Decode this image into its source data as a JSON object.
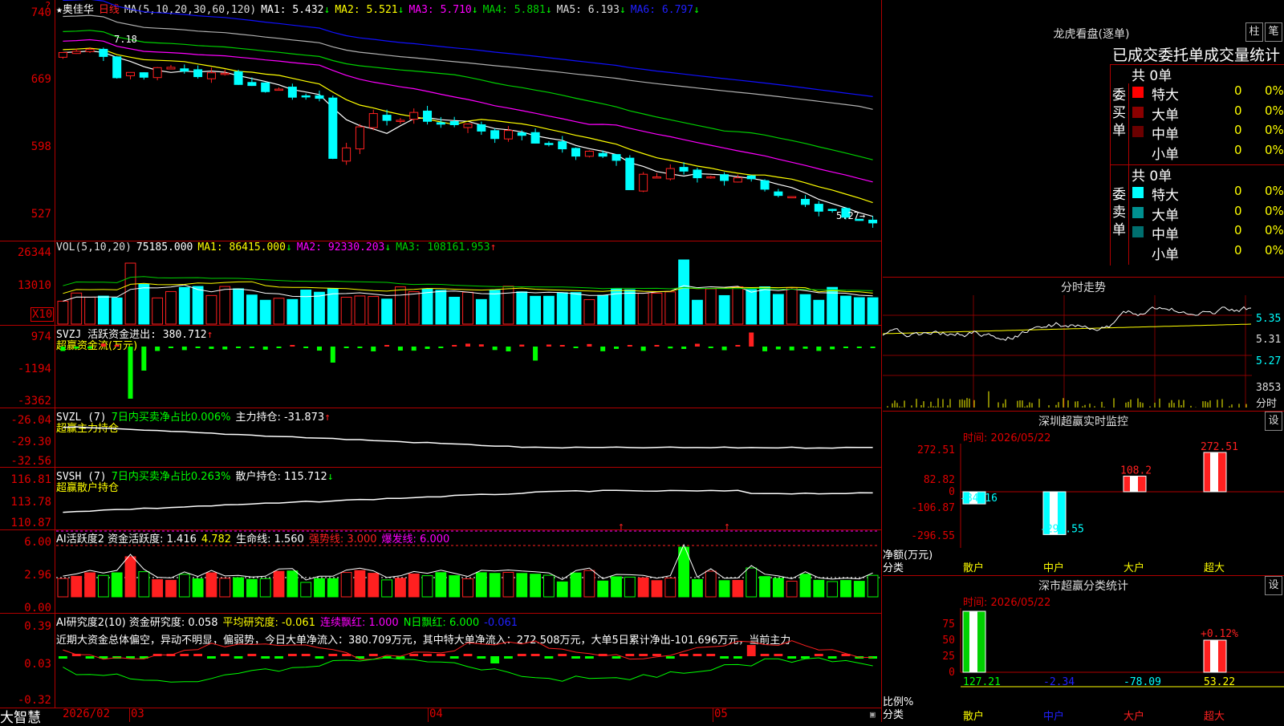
{
  "app_name": "大智慧",
  "colors": {
    "up": "#ff2020",
    "down": "#00ffff",
    "ma1": "#ffffff",
    "ma2": "#ffff00",
    "ma3": "#ff00ff",
    "ma4": "#00d000",
    "ma5": "#b0b0b0",
    "ma6": "#1010ff",
    "frame": "#b00000"
  },
  "main": {
    "star": "★",
    "stock_name": "奥佳华",
    "period": "日线",
    "ma_label": "MA(5,10,20,30,60,120)",
    "ma": [
      {
        "label": "MA1: 5.432",
        "arrow": "↓"
      },
      {
        "label": "MA2: 5.521",
        "arrow": "↓"
      },
      {
        "label": "MA3: 5.710",
        "arrow": "↓"
      },
      {
        "label": "MA4: 5.881",
        "arrow": "↓"
      },
      {
        "label": "MA5: 6.193",
        "arrow": "↓"
      },
      {
        "label": "MA6: 6.797",
        "arrow": "↓"
      }
    ],
    "y_ticks": [
      "740",
      "669",
      "598",
      "527"
    ],
    "high_marker": "7.18",
    "low_marker": "5.27→"
  },
  "vol": {
    "label": "VOL(5,10,20)",
    "value": "75185.000",
    "ma": [
      {
        "label": "MA1: 86415.000",
        "arrow": "↓"
      },
      {
        "label": "MA2: 92330.203",
        "arrow": "↓"
      },
      {
        "label": "MA3: 108161.953",
        "arrow": "↑"
      }
    ],
    "y_ticks": [
      "26344",
      "13010"
    ],
    "unit": "X10"
  },
  "svzj": {
    "label": "SVZJ  活跃资金进出: 380.712",
    "arrow": "↑",
    "sub": "超赢资金流(万元)",
    "y_ticks": [
      "974",
      "-1194",
      "-3362"
    ]
  },
  "svzl": {
    "label1": "SVZL (7)",
    "label2": "7日内买卖净占比0.006%",
    "label3": "主力持仓: -31.873",
    "arrow": "↑",
    "sub": "超赢主力持仓",
    "y_ticks": [
      "-26.04",
      "-29.30",
      "-32.56"
    ]
  },
  "svsh": {
    "label1": "SVSH (7)",
    "label2": "7日内买卖净占比0.263%",
    "label3": "散户持仓: 115.712",
    "arrow": "↓",
    "sub": "超赢散户持仓",
    "y_ticks": [
      "116.81",
      "113.78",
      "110.87"
    ]
  },
  "ai1": {
    "label": "AI活跃度2 资金活跃度: 1.416",
    "v2": "4.782",
    "v3": "生命线: 1.560",
    "v4": "强势线: 3.000",
    "v5": "爆发线: 6.000",
    "y_ticks": [
      "6.00",
      "2.96",
      "0.00"
    ]
  },
  "ai2": {
    "label": "AI研究度2(10) 资金研究度: 0.058",
    "v2": "平均研究度: -0.061",
    "v3": "连续飘红: 1.000",
    "v4": "N日飘红: 6.000",
    "v5": "-0.061",
    "y_ticks": [
      "0.39",
      "0.03",
      "-0.32"
    ],
    "comment": "近期大资金总体偏空，异动不明显，偏弱势，今日大单净流入：380.709万元，其中特大单净流入：272.508万元，大单5日累计净出-101.696万元，当前主力"
  },
  "date_axis": [
    "2026/02",
    "03",
    "04",
    "05"
  ],
  "lhb": {
    "title": "龙虎看盘(逐单)",
    "btn1": "柱",
    "btn2": "笔",
    "header": "已成交委托单成交量统计",
    "buy_title": "委买单",
    "sell_title": "委卖单",
    "buy_total": "共 0单",
    "sell_total": "共 0单",
    "buy_rows": [
      {
        "name": "特大",
        "count": "0",
        "pct": "0%",
        "color": "#ff0000"
      },
      {
        "name": "大单",
        "count": "0",
        "pct": "0%",
        "color": "#8b0000"
      },
      {
        "name": "中单",
        "count": "0",
        "pct": "0%",
        "color": "#6b0000"
      },
      {
        "name": "小单",
        "count": "0",
        "pct": "0%",
        "color": "#000000"
      }
    ],
    "sell_rows": [
      {
        "name": "特大",
        "count": "0",
        "pct": "0%",
        "color": "#00ffff"
      },
      {
        "name": "大单",
        "count": "0",
        "pct": "0%",
        "color": "#009090"
      },
      {
        "name": "中单",
        "count": "0",
        "pct": "0%",
        "color": "#006f6f"
      },
      {
        "name": "小单",
        "count": "0",
        "pct": "0%",
        "color": "#000000"
      }
    ]
  },
  "intraday": {
    "title": "分时走势",
    "y_ticks": [
      "5.35",
      "5.31",
      "5.27"
    ],
    "vol_tick": "3853",
    "vol_unit": "分时"
  },
  "sz_monitor": {
    "title": "深圳超赢实时监控",
    "btn": "设",
    "time": "时间: 2026/05/22",
    "y_ticks": [
      "272.51",
      "82.82",
      "0",
      "-106.87",
      "-296.55"
    ],
    "ylabel": "净额(万元)",
    "xlabel": "分类",
    "categories": [
      "散户",
      "中户",
      "大户",
      "超大"
    ],
    "values": [
      -84.16,
      -296.55,
      108.2,
      272.51
    ],
    "value_labels": [
      "-84.16",
      "-296.55",
      "108.2",
      "272.51"
    ]
  },
  "sz_class": {
    "title": "深市超赢分类统计",
    "btn": "设",
    "time": "时间: 2026/05/22",
    "y_ticks": [
      "75",
      "50",
      "25",
      "0"
    ],
    "ylabel": "比例%",
    "xlabel": "分类",
    "categories": [
      "散户",
      "中户",
      "大户",
      "超大"
    ],
    "values": [
      127.21,
      -2.34,
      -78.09,
      53.22
    ],
    "value_labels": [
      "127.21",
      "-2.34",
      "-78.09",
      "53.22"
    ],
    "extra_label": "+0.12%"
  }
}
